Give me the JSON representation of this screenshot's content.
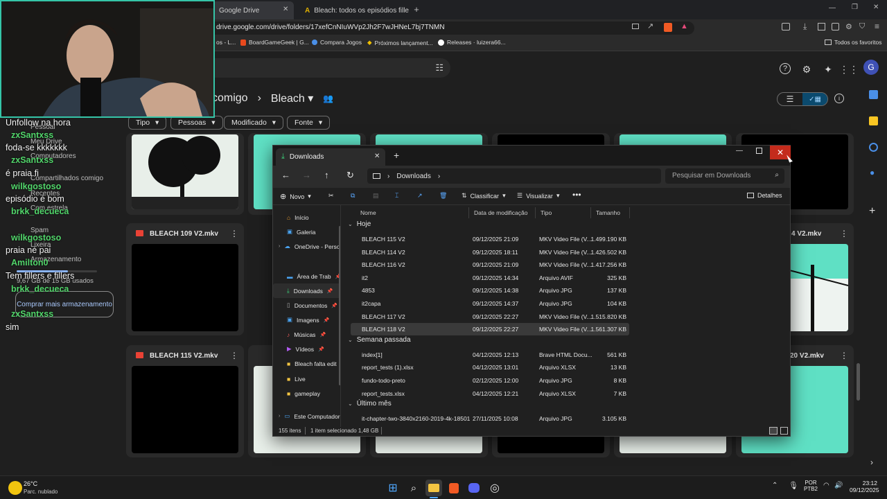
{
  "browser": {
    "tabs": [
      {
        "title": "Google Drive"
      },
      {
        "title": "Bleach: todos os episódios fillers par"
      }
    ],
    "url": "drive.google.com/drive/folders/17xefCnNIuWVp2Jh2F7wJHNeL7bj7TNMN",
    "bookmarks": [
      "os - L...",
      "BoardGameGeek | G...",
      "Compara Jogos",
      "Próximos lançament...",
      "Releases · luizera66..."
    ],
    "all_favorites": "Todos os favoritos",
    "avatar_letter": "G"
  },
  "drive": {
    "breadcrumb_parent": "comigo",
    "breadcrumb_current": "Bleach",
    "filters": [
      "Tipo",
      "Pessoas",
      "Modificado",
      "Fonte"
    ],
    "sidebar": [
      "Pessoal",
      "Meu Drive",
      "Computadores",
      "Compartilhados comigo",
      "Recentes",
      "Com estrela",
      "Spam",
      "Lixeira",
      "Armazenamento"
    ],
    "storage_text": "9,67 GB de 15 GB usados",
    "buy_storage": "Comprar mais armazenamento",
    "files": {
      "row1": [
        "BLEACH 109 V2.mkv"
      ],
      "row2": [
        "BLEACH 115 V2.mkv"
      ],
      "right_row1": "4 V2.mkv",
      "right_row2": "20 V2.mkv"
    }
  },
  "chat": [
    {
      "type": "m",
      "text": "Unfollow na hora"
    },
    {
      "type": "u",
      "text": "zxSantxss"
    },
    {
      "type": "m",
      "text": "foda-se kkkkkkk"
    },
    {
      "type": "u",
      "text": "zxSantxss"
    },
    {
      "type": "m",
      "text": "é praia fi"
    },
    {
      "type": "u",
      "text": "wilkgostoso"
    },
    {
      "type": "m",
      "text": "episódio é bom"
    },
    {
      "type": "u",
      "text": "brkk_decueca"
    },
    {
      "type": "u",
      "text": "wilkgostoso"
    },
    {
      "type": "m",
      "text": "praia né pai"
    },
    {
      "type": "u",
      "text": "Amilton0"
    },
    {
      "type": "m",
      "text": "Tem fillers e fillers"
    },
    {
      "type": "u",
      "text": "brkk_decueca"
    },
    {
      "type": "u",
      "text": "zxSantxss"
    },
    {
      "type": "m",
      "text": "sim"
    }
  ],
  "explorer": {
    "tab_title": "Downloads",
    "address": "Downloads",
    "search_placeholder": "Pesquisar em Downloads",
    "commands": {
      "new": "Novo",
      "sort": "Classificar",
      "view": "Visualizar",
      "details": "Detalhes"
    },
    "nav": [
      "Início",
      "Galeria",
      "OneDrive - Perso",
      "Área de Trab",
      "Downloads",
      "Documentos",
      "Imagens",
      "Músicas",
      "Vídeos",
      "Bleach falta edit",
      "Live",
      "gameplay",
      "Este Computador"
    ],
    "columns": {
      "name": "Nome",
      "date": "Data de modificação",
      "type": "Tipo",
      "size": "Tamanho"
    },
    "groups": [
      {
        "label": "Hoje",
        "files": [
          {
            "name": "BLEACH 115 V2",
            "date": "09/12/2025 21:09",
            "type": "MKV Video File (V...",
            "size": "1.499.190 KB",
            "icon": "vlc"
          },
          {
            "name": "BLEACH 114 V2",
            "date": "09/12/2025 18:11",
            "type": "MKV Video File (V...",
            "size": "1.426.502 KB",
            "icon": "vlc"
          },
          {
            "name": "BLEACH 116 V2",
            "date": "09/12/2025 21:09",
            "type": "MKV Video File (V...",
            "size": "1.417.256 KB",
            "icon": "vlc"
          },
          {
            "name": "it2",
            "date": "09/12/2025 14:34",
            "type": "Arquivo AVIF",
            "size": "325 KB",
            "icon": "img"
          },
          {
            "name": "4853",
            "date": "09/12/2025 14:38",
            "type": "Arquivo JPG",
            "size": "137 KB",
            "icon": "img"
          },
          {
            "name": "it2capa",
            "date": "09/12/2025 14:37",
            "type": "Arquivo JPG",
            "size": "104 KB",
            "icon": "img"
          },
          {
            "name": "BLEACH 117 V2",
            "date": "09/12/2025 22:27",
            "type": "MKV Video File (V...",
            "size": "1.515.820 KB",
            "icon": "vlc"
          },
          {
            "name": "BLEACH 118 V2",
            "date": "09/12/2025 22:27",
            "type": "MKV Video File (V...",
            "size": "1.561.307 KB",
            "icon": "vlc",
            "selected": true
          }
        ]
      },
      {
        "label": "Semana passada",
        "files": [
          {
            "name": "index[1]",
            "date": "04/12/2025 12:13",
            "type": "Brave HTML Docu...",
            "size": "561 KB",
            "icon": "brave"
          },
          {
            "name": "report_tests (1).xlsx",
            "date": "04/12/2025 13:01",
            "type": "Arquivo XLSX",
            "size": "13 KB",
            "icon": "doc"
          },
          {
            "name": "fundo-todo-preto",
            "date": "02/12/2025 12:00",
            "type": "Arquivo JPG",
            "size": "8 KB",
            "icon": "img"
          },
          {
            "name": "report_tests.xlsx",
            "date": "04/12/2025 12:21",
            "type": "Arquivo XLSX",
            "size": "7 KB",
            "icon": "doc"
          }
        ]
      },
      {
        "label": "Último mês",
        "files": [
          {
            "name": "it-chapter-two-3840x2160-2019-4k-18501",
            "date": "27/11/2025 10:08",
            "type": "Arquivo JPG",
            "size": "3.105 KB",
            "icon": "img"
          }
        ]
      }
    ],
    "status": {
      "count": "155 itens",
      "selected": "1 item selecionado 1,48 GB"
    }
  },
  "taskbar": {
    "weather_temp": "26°C",
    "weather_desc": "Parc. nublado",
    "lang": "POR",
    "layout": "PTB2",
    "time": "23:12",
    "date": "09/12/2025"
  },
  "colors": {
    "accent": "#c42b1c",
    "webcam_border": "#35c5a8",
    "chat_user": "#52d66b"
  }
}
